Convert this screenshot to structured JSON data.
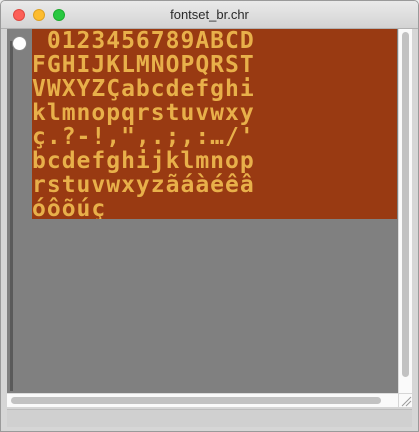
{
  "window": {
    "title": "fontset_br.chr"
  },
  "font_sheet": {
    "rows": [
      " 0123456789ABCD",
      "FGHIJKLMNOPQRST",
      "VWXYZÇabcdefghi",
      "klmnopqrstuvwxy",
      "ç.?-!,\",.;,:…/'",
      "bcdefghijklmnop",
      "rstuvwxyzãáàéêâ",
      "óôõúç"
    ],
    "colors": {
      "background": "#993a12",
      "glyph": "#e8b04a"
    }
  }
}
